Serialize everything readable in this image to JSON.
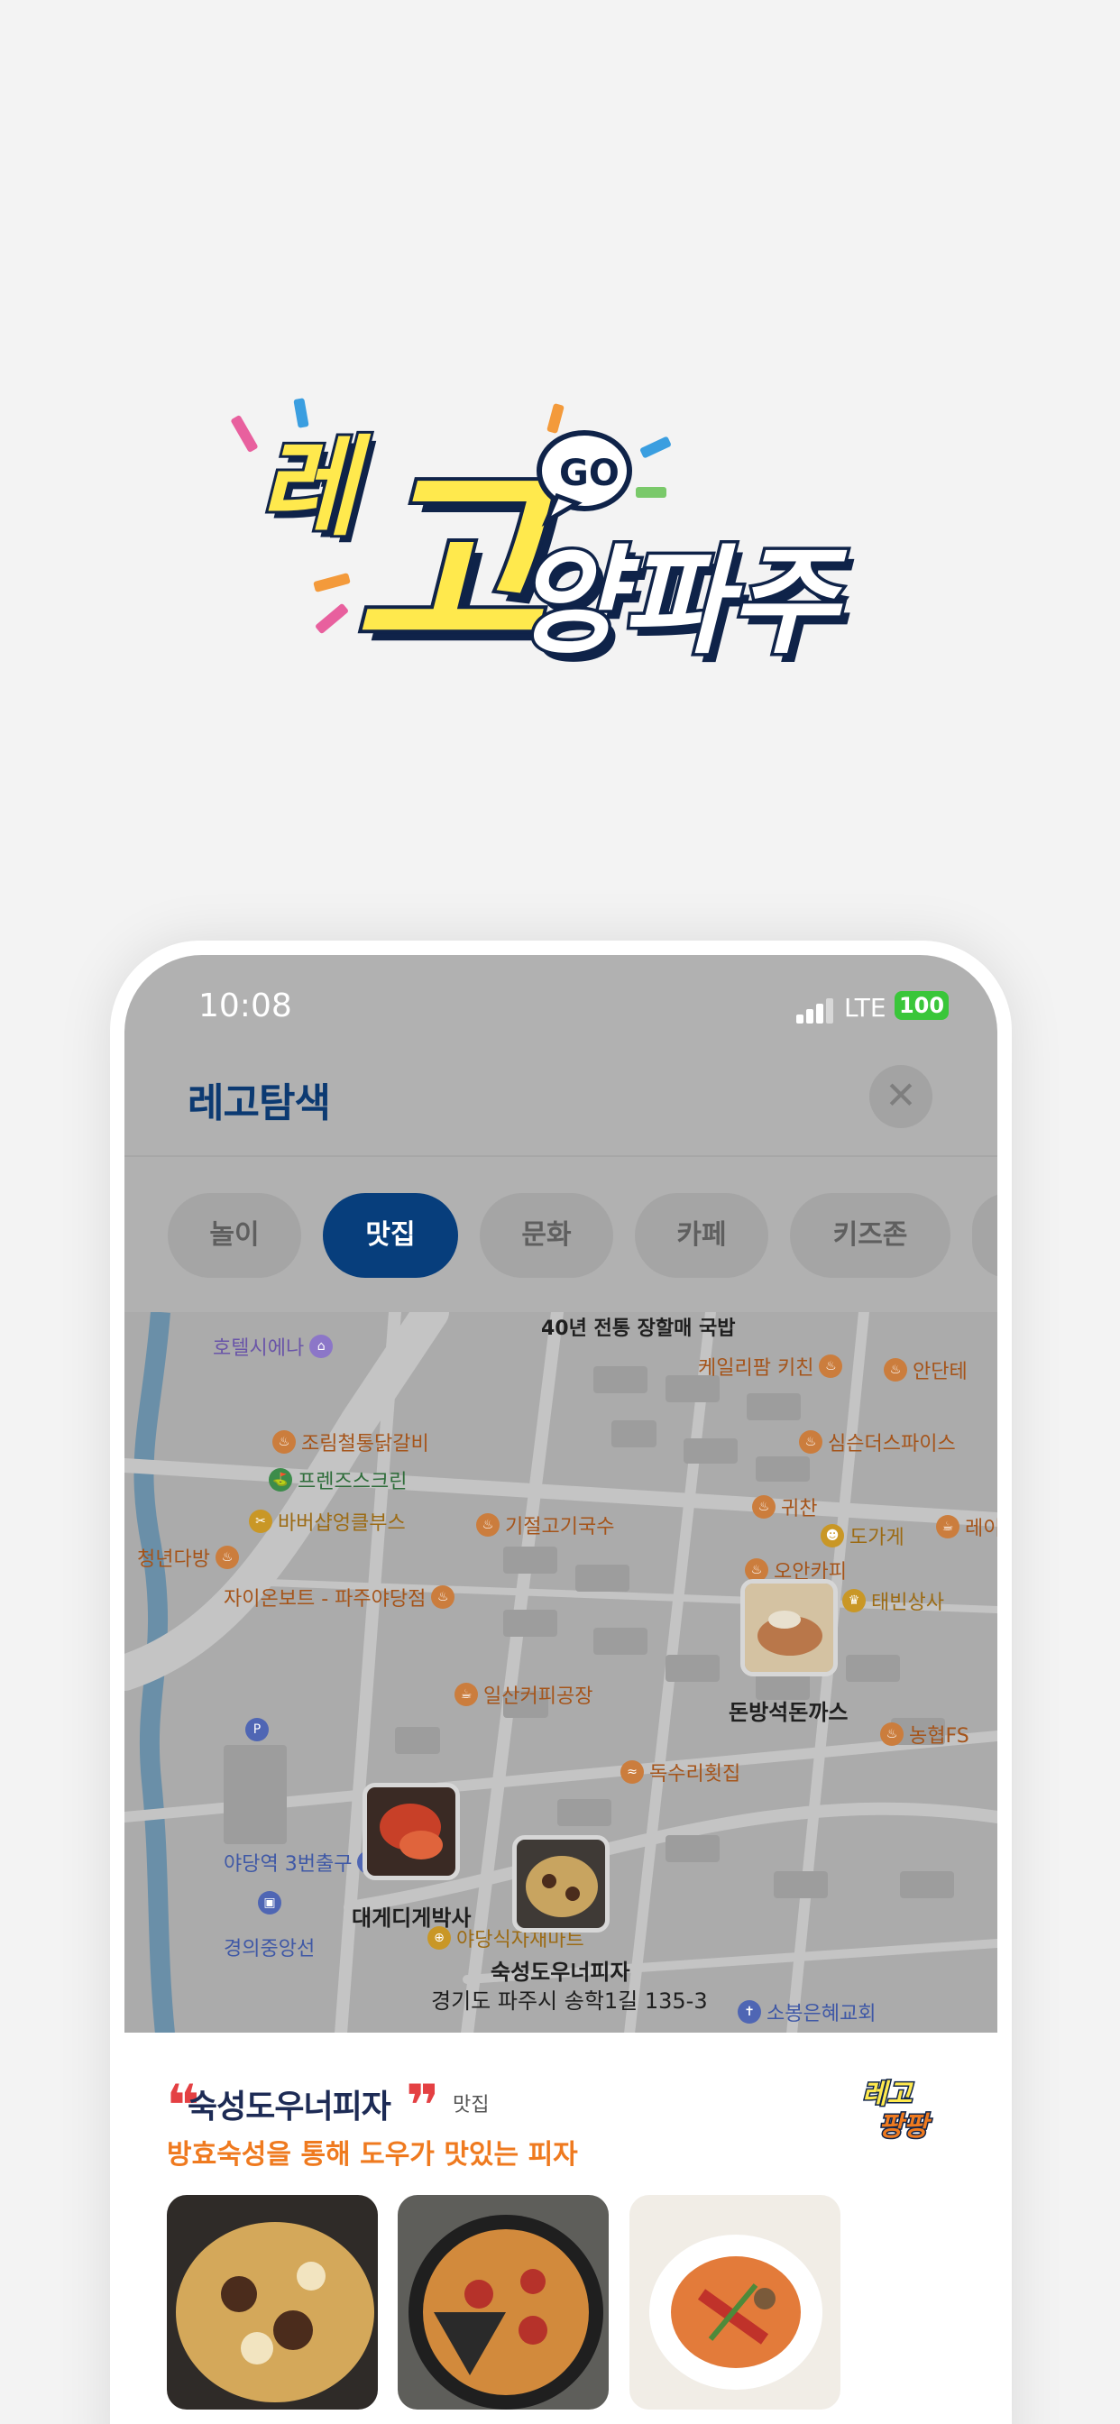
{
  "logo": {
    "word1": "레",
    "word2": "고",
    "go": "GO",
    "word3": "양파주"
  },
  "status": {
    "time": "10:08",
    "network": "LTE",
    "battery": "100"
  },
  "header": {
    "title": "레고탐색",
    "close_icon": "close-icon"
  },
  "tabs": [
    {
      "label": "놀이",
      "active": false
    },
    {
      "label": "맛집",
      "active": true
    },
    {
      "label": "문화",
      "active": false
    },
    {
      "label": "카페",
      "active": false
    },
    {
      "label": "키즈존",
      "active": false
    }
  ],
  "map": {
    "places": [
      "40년 전통 장할매 국밥",
      "호텔시에나",
      "케일리팜 키친",
      "안단테",
      "조림철통닭갈비",
      "심슨더스파이스",
      "프렌즈스크린",
      "귀찬",
      "바버샵엉클부스",
      "기절고기국수",
      "도가게",
      "레이",
      "청년다방",
      "오안카피",
      "자이온보트 - 파주야당점",
      "태빈상사",
      "일산커피공장",
      "농협FS",
      "독수리횟집",
      "야당역 3번출구",
      "경의중앙선",
      "야당식자재마트",
      "소봉은혜교회"
    ],
    "markers": [
      {
        "label": "돈방석돈까스"
      },
      {
        "label": "대게디게박사"
      },
      {
        "label": "숙성도우너피자",
        "address": "경기도 파주시 송학1길 135-3"
      }
    ]
  },
  "sheet": {
    "name": "숙성도우너피자",
    "category": "맛집",
    "description": "방효숙성을 통해 도우가 맛있는 피자",
    "mini_logo_top": "레고",
    "mini_logo_bottom": "팡팡"
  },
  "colors": {
    "accent": "#073e7c",
    "highlight": "#ef7a1f",
    "logo_yellow": "#ffe94d",
    "logo_navy": "#0f2349"
  }
}
